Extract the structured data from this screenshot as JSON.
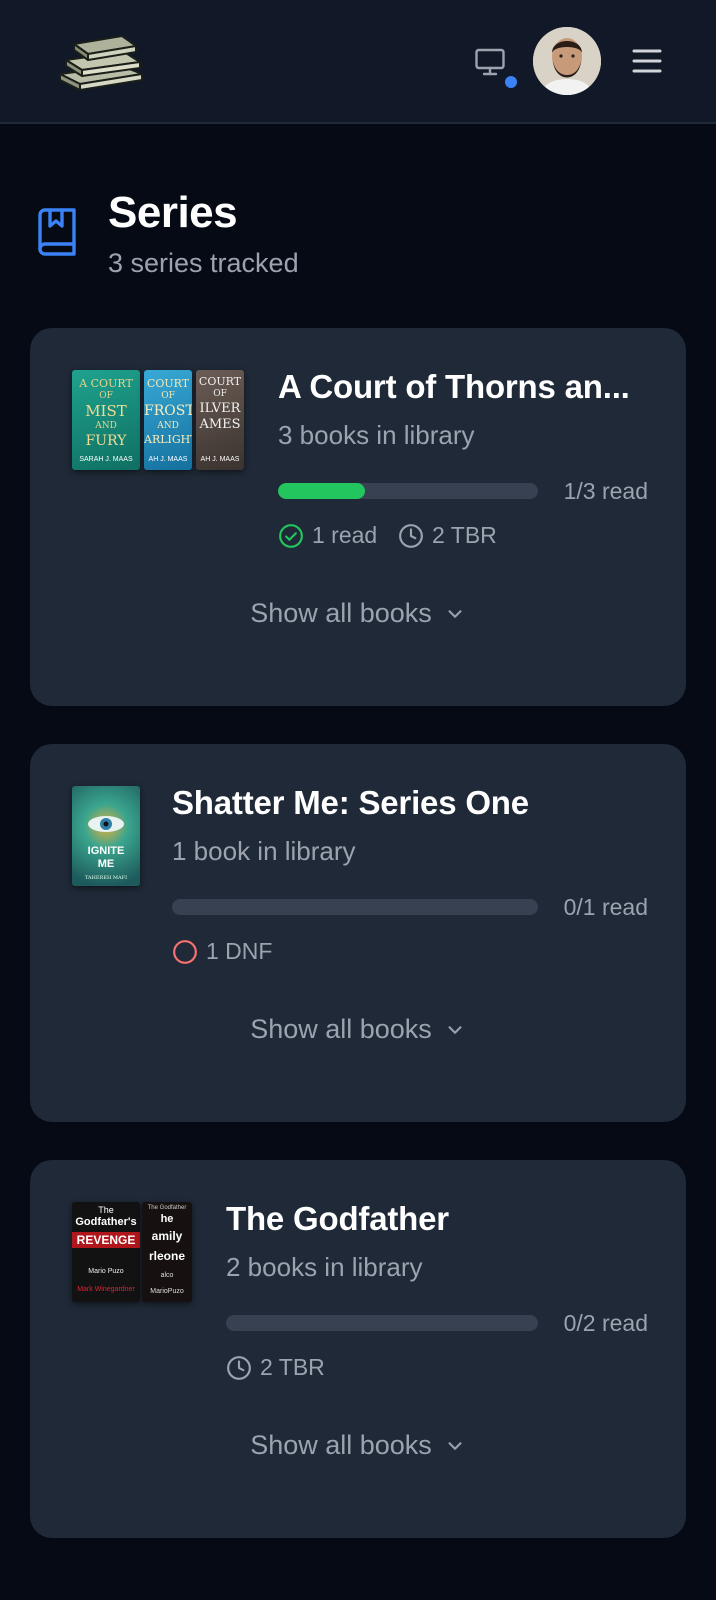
{
  "header": {
    "monitor_icon": "monitor-icon",
    "notification_color": "#3b82f6",
    "menu_icon": "hamburger-menu-icon"
  },
  "page": {
    "title": "Series",
    "subtitle": "3 series tracked",
    "icon": "book-bookmark-icon",
    "accent": "#3b82f6"
  },
  "series": [
    {
      "title": "A Court of Thorns an...",
      "books_in_library": "3 books in library",
      "progress_label": "1/3 read",
      "progress": 0.3333,
      "stats": [
        {
          "icon": "check-circle-icon",
          "label": "1 read",
          "color": "#22c55e"
        },
        {
          "icon": "clock-icon",
          "label": "2 TBR",
          "color": "#9ca3af"
        }
      ],
      "show_all": "Show all books",
      "covers": [
        {
          "lines": [
            "A COURT",
            "OF",
            "MIST",
            "AND",
            "FURY"
          ],
          "author": "SARAH J. MAAS"
        },
        {
          "lines": [
            "COURT",
            "OF",
            "FROST",
            "AND",
            "ARLIGHT"
          ],
          "author": "AH J. MAAS"
        },
        {
          "lines": [
            "COURT",
            "OF",
            "ILVER",
            "AMES"
          ],
          "author": "AH J. MAAS"
        }
      ]
    },
    {
      "title": "Shatter Me: Series One",
      "books_in_library": "1 book in library",
      "progress_label": "0/1 read",
      "progress": 0,
      "stats": [
        {
          "icon": "circle-icon",
          "label": "1 DNF",
          "color": "#f87171"
        }
      ],
      "show_all": "Show all books",
      "covers": [
        {
          "lines": [
            "IGNITE",
            "ME"
          ],
          "author": "TAHEREH MAFI"
        }
      ]
    },
    {
      "title": "The Godfather",
      "books_in_library": "2 books in library",
      "progress_label": "0/2 read",
      "progress": 0,
      "stats": [
        {
          "icon": "clock-icon",
          "label": "2 TBR",
          "color": "#9ca3af"
        }
      ],
      "show_all": "Show all books",
      "covers": [
        {
          "lines": [
            "The",
            "Godfather's",
            "REVENGE"
          ],
          "author": "Mark Winegardner",
          "top": "Mario Puzo"
        },
        {
          "lines": [
            "he",
            "amily",
            "rleone"
          ],
          "author": "MarioPuzo",
          "top": "The Godfather",
          "extra": "alco"
        }
      ]
    }
  ]
}
